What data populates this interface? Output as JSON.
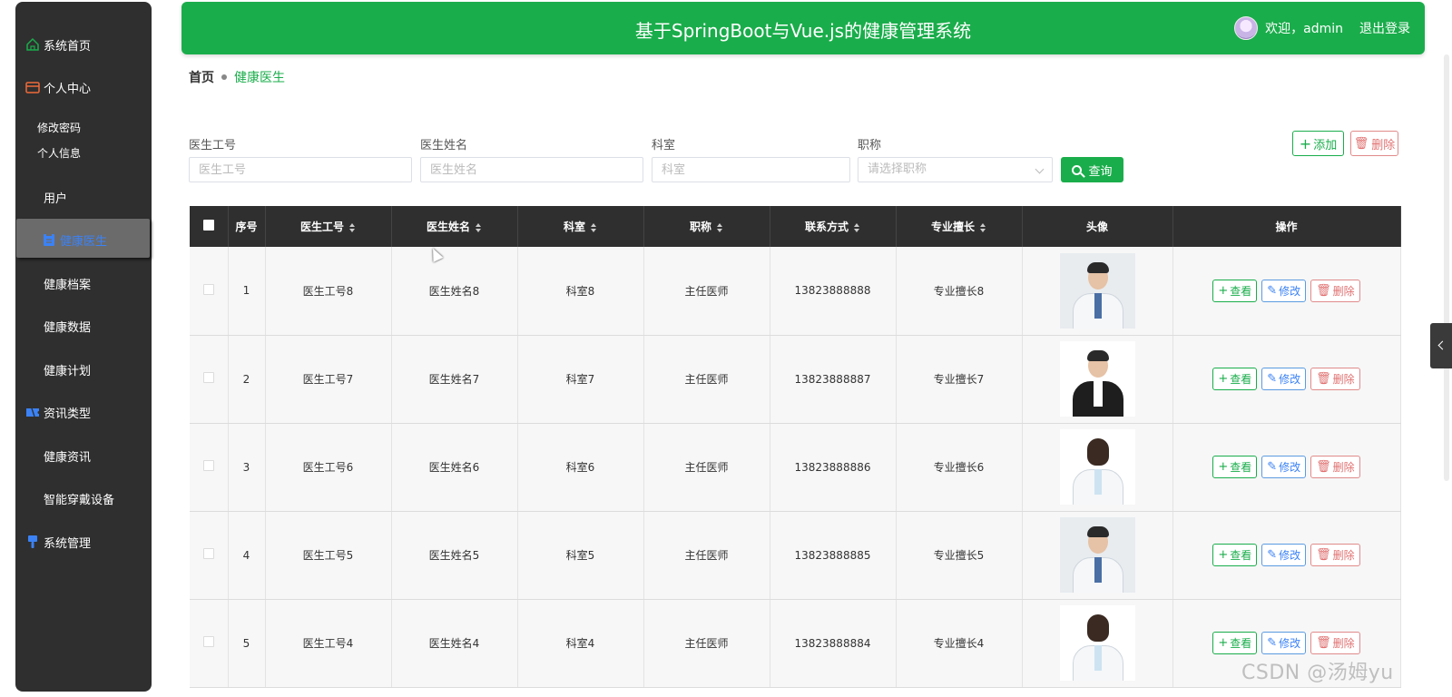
{
  "header": {
    "title": "基于SpringBoot与Vue.js的健康管理系统",
    "welcome": "欢迎，admin",
    "logout": "退出登录"
  },
  "sidebar": {
    "items": [
      {
        "label": "系统首页",
        "icon": "home-icon"
      },
      {
        "label": "个人中心",
        "icon": "wallet-icon"
      },
      {
        "label": "修改密码"
      },
      {
        "label": "个人信息"
      },
      {
        "label": "用户",
        "icon": "grid-icon"
      },
      {
        "label": "健康医生",
        "icon": "clipboard-icon"
      },
      {
        "label": "健康档案",
        "icon": "grid-icon"
      },
      {
        "label": "健康数据",
        "icon": "grid-icon"
      },
      {
        "label": "健康计划",
        "icon": "grid-icon"
      },
      {
        "label": "资讯类型",
        "icon": "ticket-icon"
      },
      {
        "label": "健康资讯",
        "icon": "grid-icon"
      },
      {
        "label": "智能穿戴设备",
        "icon": "grid-icon"
      },
      {
        "label": "系统管理",
        "icon": "brush-icon"
      }
    ],
    "colors": {
      "background": "#2f2f2f",
      "active_text": "#3b82f6",
      "icon": "#3b82f6"
    }
  },
  "breadcrumb": {
    "home": "首页",
    "current": "健康医生"
  },
  "search": {
    "fields": [
      {
        "label": "医生工号",
        "placeholder": "医生工号"
      },
      {
        "label": "医生姓名",
        "placeholder": "医生姓名"
      },
      {
        "label": "科室",
        "placeholder": "科室"
      },
      {
        "label": "职称",
        "placeholder": "请选择职称"
      }
    ],
    "query_label": "查询",
    "add_label": "添加",
    "delete_label": "删除"
  },
  "table": {
    "columns": [
      "序号",
      "医生工号",
      "医生姓名",
      "科室",
      "职称",
      "联系方式",
      "专业擅长",
      "头像",
      "操作"
    ],
    "rows": [
      {
        "index": "1",
        "id": "医生工号8",
        "name": "医生姓名8",
        "dept": "科室8",
        "title": "主任医师",
        "phone": "13823888888",
        "specialty": "专业擅长8",
        "photo": "doctor-photo-male-coat"
      },
      {
        "index": "2",
        "id": "医生工号7",
        "name": "医生姓名7",
        "dept": "科室7",
        "title": "主任医师",
        "phone": "13823888887",
        "specialty": "专业擅长7",
        "photo": "doctor-photo-male-suit"
      },
      {
        "index": "3",
        "id": "医生工号6",
        "name": "医生姓名6",
        "dept": "科室6",
        "title": "主任医师",
        "phone": "13823888886",
        "specialty": "专业擅长6",
        "photo": "doctor-photo-female-mask"
      },
      {
        "index": "4",
        "id": "医生工号5",
        "name": "医生姓名5",
        "dept": "科室5",
        "title": "主任医师",
        "phone": "13823888885",
        "specialty": "专业擅长5",
        "photo": "doctor-photo-male-coat"
      },
      {
        "index": "5",
        "id": "医生工号4",
        "name": "医生姓名4",
        "dept": "科室4",
        "title": "主任医师",
        "phone": "13823888884",
        "specialty": "专业擅长4",
        "photo": "doctor-photo-female"
      }
    ],
    "actions": {
      "view": "查看",
      "edit": "修改",
      "delete": "删除"
    }
  },
  "watermark": "CSDN @汤姆yu",
  "colors": {
    "primary": "#1aad4b",
    "header_bg": "#2f2f2f",
    "danger": "#e07070",
    "info": "#3b82f6"
  }
}
